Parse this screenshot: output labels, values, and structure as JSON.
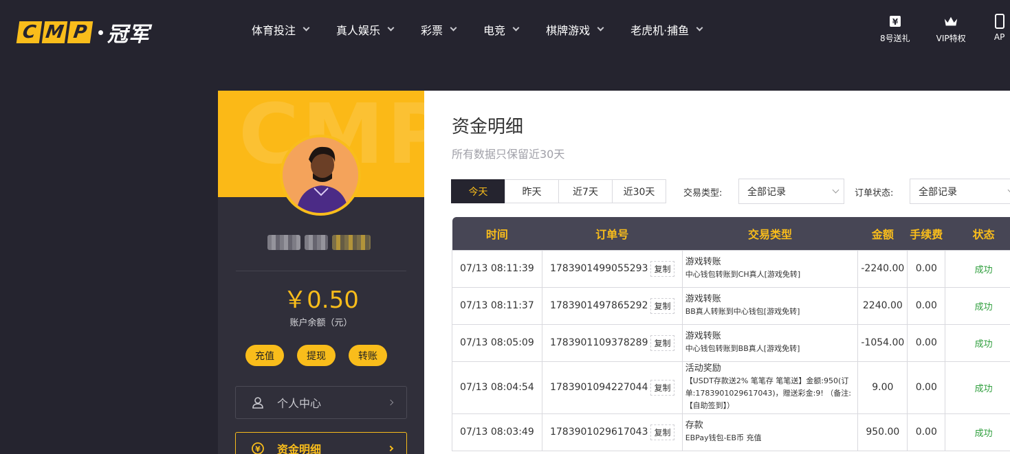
{
  "brand": {
    "logo_letters": [
      "C",
      "M",
      "P"
    ],
    "logo_text": "冠军"
  },
  "nav": [
    {
      "label": "体育投注"
    },
    {
      "label": "真人娱乐"
    },
    {
      "label": "彩票"
    },
    {
      "label": "电竞"
    },
    {
      "label": "棋牌游戏"
    },
    {
      "label": "老虎机·捕鱼"
    }
  ],
  "top_right": [
    {
      "label": "8号送礼",
      "icon": "gift-icon"
    },
    {
      "label": "VIP特权",
      "icon": "crown-icon"
    },
    {
      "label": "AP",
      "icon": "app-icon"
    }
  ],
  "profile": {
    "banner_watermark": "CMP",
    "balance": "￥0.50",
    "balance_label": "账户余额（元）",
    "actions": [
      "充值",
      "提现",
      "转账"
    ],
    "menu": [
      {
        "label": "个人中心",
        "icon": "user-icon"
      },
      {
        "label": "资金明细",
        "icon": "money-icon"
      }
    ]
  },
  "page": {
    "title": "资金明细",
    "subtitle": "所有数据只保留近30天",
    "tabs": [
      "今天",
      "昨天",
      "近7天",
      "近30天"
    ],
    "filters": [
      {
        "label": "交易类型:",
        "value": "全部记录"
      },
      {
        "label": "订单状态:",
        "value": "全部记录"
      }
    ]
  },
  "table": {
    "headers": [
      "时间",
      "订单号",
      "交易类型",
      "金额",
      "手续费",
      "状态"
    ],
    "copy_label": "复制",
    "rows": [
      {
        "time": "07/13 08:11:39",
        "order": "1783901499055293",
        "type": "游戏转账",
        "detail": "中心钱包转账到CH真人[游戏免转]",
        "amount": "-2240.00",
        "fee": "0.00",
        "status": "成功"
      },
      {
        "time": "07/13 08:11:37",
        "order": "1783901497865292",
        "type": "游戏转账",
        "detail": "BB真人转账到中心钱包[游戏免转]",
        "amount": "2240.00",
        "fee": "0.00",
        "status": "成功"
      },
      {
        "time": "07/13 08:05:09",
        "order": "1783901109378289",
        "type": "游戏转账",
        "detail": "中心钱包转账到BB真人[游戏免转]",
        "amount": "-1054.00",
        "fee": "0.00",
        "status": "成功"
      },
      {
        "time": "07/13 08:04:54",
        "order": "1783901094227044",
        "type": "活动奖励",
        "detail": "【USDT存款送2% 笔笔存 笔笔送】金额:950(订单:1783901029617043)，赠送彩金:9! （备注:【自助签到】）",
        "amount": "9.00",
        "fee": "0.00",
        "status": "成功"
      },
      {
        "time": "07/13 08:03:49",
        "order": "1783901029617043",
        "type": "存款",
        "detail": "EBPay钱包-EB币 充值",
        "amount": "950.00",
        "fee": "0.00",
        "status": "成功"
      }
    ]
  },
  "colors": {
    "accent": "#f9bd1b",
    "bg_dark": "#25242f",
    "panel": "#302f3a",
    "success": "#2e9e3c"
  }
}
